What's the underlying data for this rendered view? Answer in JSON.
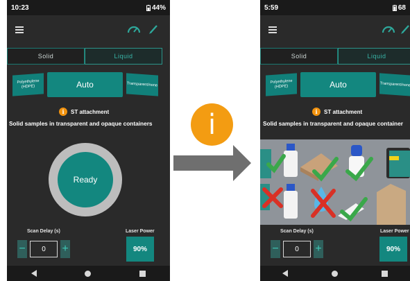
{
  "left_phone": {
    "status": {
      "time": "10:23",
      "battery": "44%"
    },
    "tabs": {
      "solid": "Solid",
      "liquid": "Liquid"
    },
    "modes": {
      "left": "Polyethylene (HDPE)",
      "auto": "Auto",
      "right": "Transparent/none"
    },
    "attachment": {
      "icon": "i",
      "label": "ST attachment"
    },
    "description": "Solid samples in transparent and opaque containers",
    "ready_button": "Ready",
    "scan_delay": {
      "label": "Scan Delay (s)",
      "value": "0",
      "minus": "−",
      "plus": "+"
    },
    "laser_power": {
      "label": "Laser Power",
      "value": "90%"
    }
  },
  "info_bubble": "i",
  "right_phone": {
    "status": {
      "time": "5:59",
      "battery": "68"
    },
    "tabs": {
      "solid": "Solid",
      "liquid": "Liquid"
    },
    "modes": {
      "left": "Polyethylene (HDPE)",
      "auto": "Auto",
      "right": "Transparent/none"
    },
    "attachment": {
      "icon": "i",
      "label": "ST attachment"
    },
    "description": "Solid samples in transparent and opaque container",
    "scan_delay": {
      "label": "Scan Delay (s)",
      "value": "0",
      "minus": "−",
      "plus": "+"
    },
    "laser_power": {
      "label": "Laser Power",
      "value": "90%"
    }
  },
  "colors": {
    "accent": "#13877f",
    "info": "#f39c12",
    "check": "#3aa84a",
    "cross": "#d93025"
  }
}
